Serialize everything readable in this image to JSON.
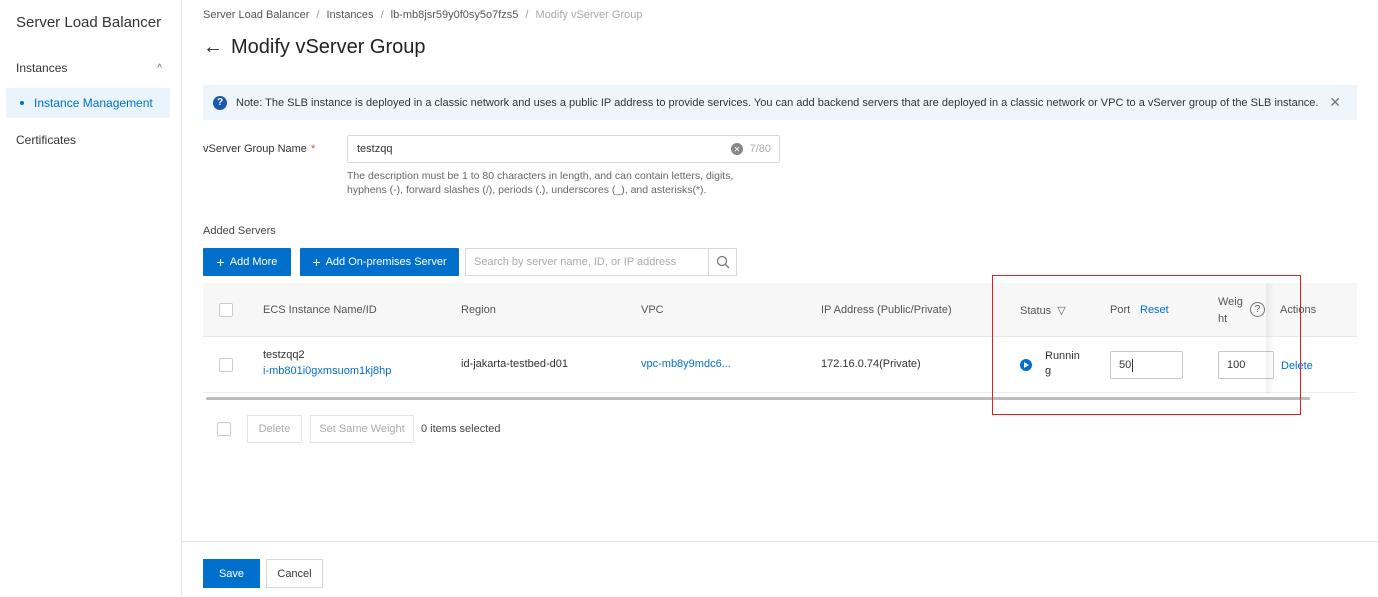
{
  "sidebar": {
    "title": "Server Load Balancer",
    "group_label": "Instances",
    "active_item": "Instance Management",
    "certificates": "Certificates"
  },
  "breadcrumb": {
    "items": [
      "Server Load Balancer",
      "Instances",
      "lb-mb8jsr59y0f0sy5o7fzs5"
    ],
    "current": "Modify vServer Group"
  },
  "page": {
    "title": "Modify vServer Group"
  },
  "note": {
    "text": "Note: The SLB instance is deployed in a classic network and uses a public IP address to provide services. You can add backend servers that are deployed in a classic network or VPC to a vServer group of the SLB instance."
  },
  "form": {
    "name_label": "vServer Group Name",
    "required_mark": "*",
    "name_value": "testzqq",
    "char_count": "7/80",
    "hint": "The description must be 1 to 80 characters in length, and can contain letters, digits, hyphens (-), forward slashes (/), periods (.), underscores (_), and asterisks(*)."
  },
  "servers": {
    "section_label": "Added Servers",
    "add_more_label": "Add More",
    "add_onprem_label": "Add On-premises Server",
    "search_placeholder": "Search by server name, ID, or IP address"
  },
  "table": {
    "headers": {
      "instance": "ECS Instance Name/ID",
      "region": "Region",
      "vpc": "VPC",
      "ip": "IP Address (Public/Private)",
      "status": "Status",
      "port": "Port",
      "port_reset": "Reset",
      "weight_line1": "Weig",
      "weight_line2": "ht",
      "actions": "Actions"
    },
    "rows": [
      {
        "name": "testzqq2",
        "id": "i-mb801i0gxmsuom1kj8hp",
        "region": "id-jakarta-testbed-d01",
        "vpc": "vpc-mb8y9mdc6...",
        "ip": "172.16.0.74(Private)",
        "status_line1": "Runnin",
        "status_line2": "g",
        "port": "50",
        "weight": "100",
        "action": "Delete"
      }
    ]
  },
  "bulk": {
    "delete_label": "Delete",
    "same_weight_label": "Set Same Weight",
    "selected_text": "0 items selected"
  },
  "footer": {
    "save_label": "Save",
    "cancel_label": "Cancel"
  },
  "colors": {
    "primary": "#0070cc",
    "highlight_box": "#e02020",
    "note_bg": "#eef6fc"
  }
}
